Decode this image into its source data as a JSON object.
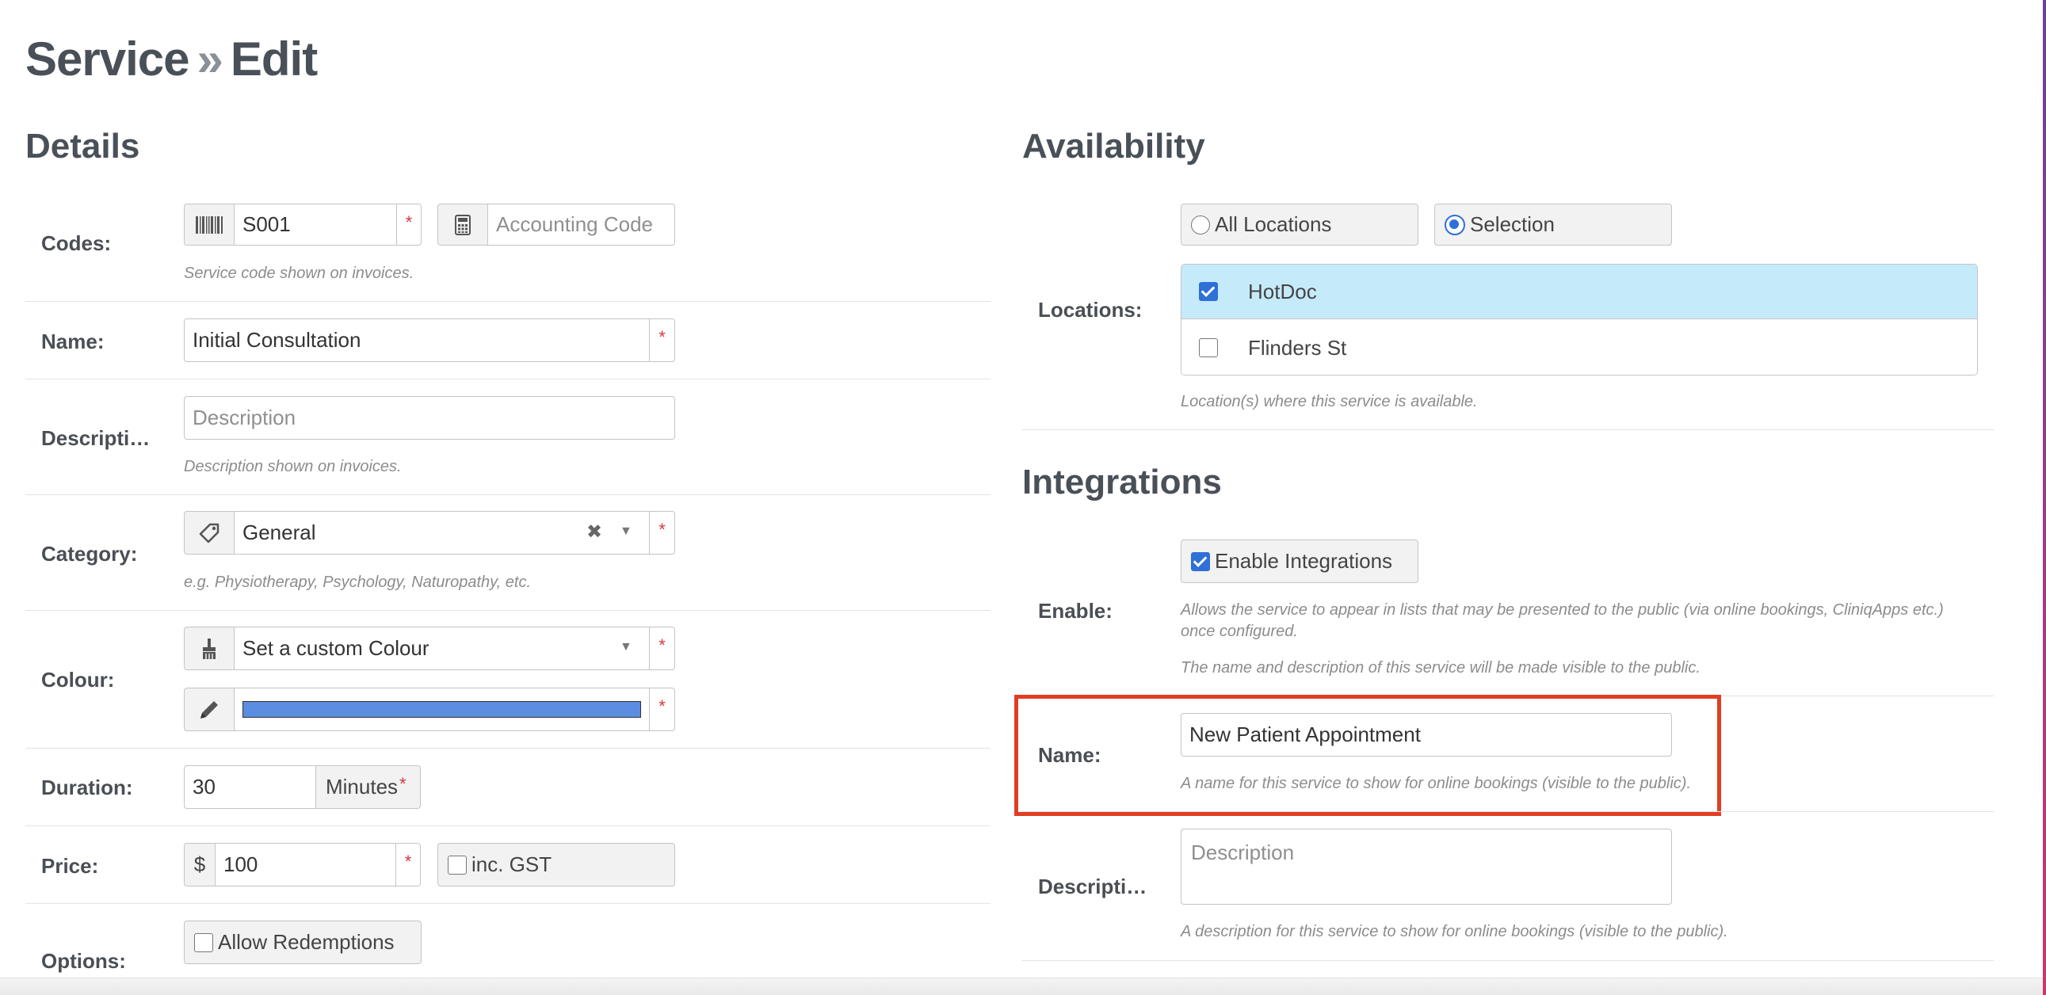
{
  "page": {
    "title": "Service",
    "sep": "»",
    "subtitle": "Edit"
  },
  "details": {
    "heading": "Details",
    "codes": {
      "label": "Codes:",
      "code_value": "S001",
      "required": "*",
      "accounting_placeholder": "Accounting Code",
      "help": "Service code shown on invoices."
    },
    "name": {
      "label": "Name:",
      "value": "Initial Consultation",
      "required": "*"
    },
    "description": {
      "label": "Descripti…",
      "placeholder": "Description",
      "help": "Description shown on invoices."
    },
    "category": {
      "label": "Category:",
      "value": "General",
      "clear": "✖",
      "caret": "▼",
      "required": "*",
      "help": "e.g. Physiotherapy, Psychology, Naturopathy, etc."
    },
    "colour": {
      "label": "Colour:",
      "value": "Set a custom Colour",
      "caret": "▼",
      "required": "*",
      "swatch_color": "#5b8de0",
      "swatch_required": "*"
    },
    "duration": {
      "label": "Duration:",
      "value": "30",
      "unit": "Minutes",
      "required": "*"
    },
    "price": {
      "label": "Price:",
      "currency": "$",
      "value": "100",
      "required": "*",
      "gst_label": "inc. GST"
    },
    "options": {
      "label": "Options:",
      "redemptions_label": "Allow Redemptions"
    }
  },
  "availability": {
    "heading": "Availability",
    "locations_label": "Locations:",
    "all_locations": "All Locations",
    "selection": "Selection",
    "locations": [
      {
        "name": "HotDoc",
        "checked": true
      },
      {
        "name": "Flinders St",
        "checked": false
      }
    ],
    "help": "Location(s) where this service is available."
  },
  "integrations": {
    "heading": "Integrations",
    "enable_label": "Enable:",
    "enable_button": "Enable Integrations",
    "enable_help_1": "Allows the service to appear in lists that may be presented to the public (via online bookings, CliniqApps etc.) once configured.",
    "enable_help_2": "The name and description of this service will be made visible to the public.",
    "name_label": "Name:",
    "name_value": "New Patient Appointment",
    "name_help": "A name for this service to show for online bookings (visible to the public).",
    "desc_label": "Descripti…",
    "desc_placeholder": "Description",
    "desc_help": "A description for this service to show for online bookings (visible to the public)."
  },
  "colors": {
    "highlight": "#e03e24",
    "selected_row": "#c5ebfb",
    "accent": "#2f6fd8"
  }
}
